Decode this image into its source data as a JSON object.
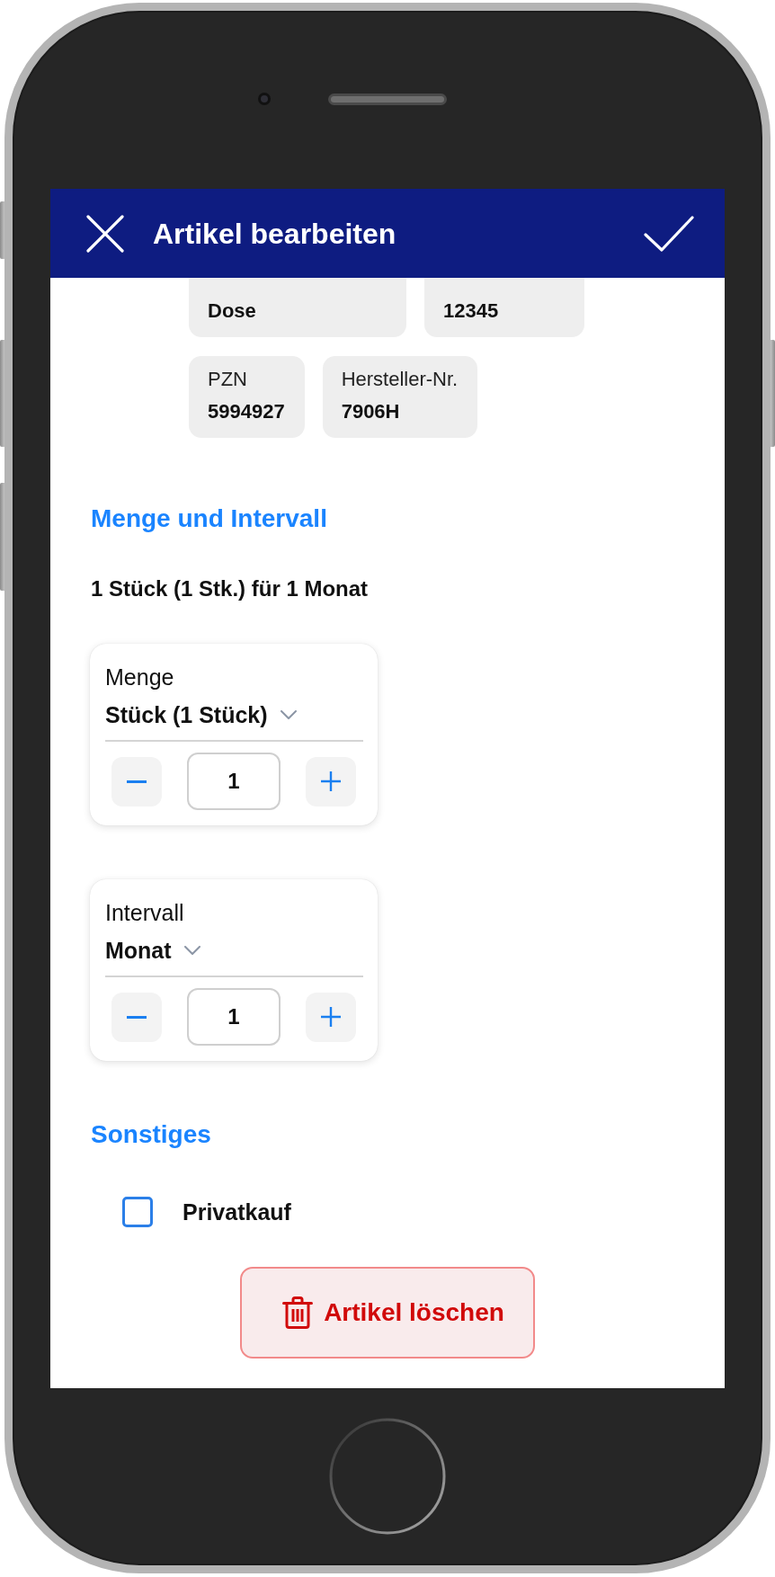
{
  "header": {
    "title": "Artikel bearbeiten"
  },
  "attributes": [
    [
      {
        "value": "Dose"
      },
      {
        "value": "12345"
      }
    ],
    [
      {
        "label": "PZN",
        "value": "5994927"
      },
      {
        "label": "Hersteller-Nr.",
        "value": "7906H"
      }
    ]
  ],
  "quantity_section": {
    "heading": "Menge und Intervall",
    "summary": "1 Stück (1 Stk.) für 1 Monat",
    "steppers": [
      {
        "label": "Menge",
        "unit": "Stück (1 Stück)",
        "value": "1"
      },
      {
        "label": "Intervall",
        "unit": "Monat",
        "value": "1"
      }
    ]
  },
  "other_section": {
    "heading": "Sonstiges",
    "checkboxes": [
      {
        "label": "Privatkauf",
        "checked": false
      }
    ]
  },
  "delete_button": {
    "label": "Artikel löschen"
  }
}
